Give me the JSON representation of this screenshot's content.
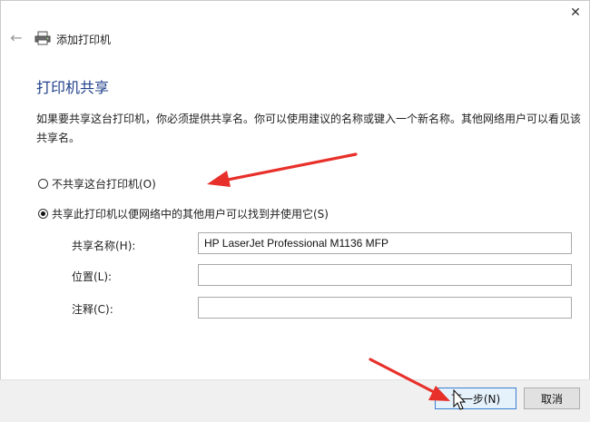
{
  "window": {
    "title": "添加打印机",
    "close_glyph": "✕",
    "back_glyph": "←"
  },
  "content": {
    "heading": "打印机共享",
    "description": "如果要共享这台打印机，你必须提供共享名。你可以使用建议的名称或键入一个新名称。其他网络用户可以看见该共享名。"
  },
  "options": {
    "no_share_label": "不共享这台打印机(O)",
    "share_label": "共享此打印机以便网络中的其他用户可以找到并使用它(S)",
    "selected": "share"
  },
  "fields": {
    "share_name": {
      "label": "共享名称(H):",
      "value": "HP LaserJet Professional M1136 MFP"
    },
    "location": {
      "label": "位置(L):",
      "value": ""
    },
    "comment": {
      "label": "注释(C):",
      "value": ""
    }
  },
  "buttons": {
    "next_label": "下一步(N)",
    "cancel_label": "取消"
  },
  "colors": {
    "heading": "#1f3f8a",
    "annotation_arrow": "#e8302a",
    "footer_bg": "#f0f0f0",
    "primary_button_border": "#3c7fd0"
  },
  "icons": [
    "close-icon",
    "back-arrow-icon",
    "printer-icon",
    "mouse-cursor-icon"
  ]
}
